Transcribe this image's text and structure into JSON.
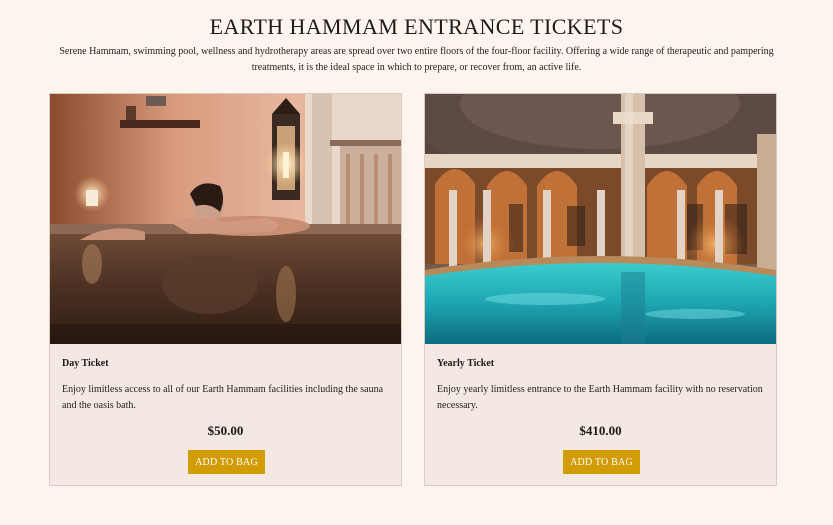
{
  "header": {
    "title": "EARTH HAMMAM ENTRANCE TICKETS",
    "intro": "Serene Hammam, swimming pool, wellness and hydrotherapy areas are spread over two entire floors of the four-floor facility. Offering a wide range of therapeutic and pampering treatments, it is the ideal space in which to prepare, or recover from, an active life."
  },
  "products": [
    {
      "name": "Day Ticket",
      "description": "Enjoy limitless access to all of our Earth Hammam facilities including the sauna and the oasis bath.",
      "price": "$50.00",
      "button_label": "ADD TO BAG"
    },
    {
      "name": "Yearly Ticket",
      "description": "Enjoy yearly limitless entrance to the Earth Hammam facility with no reservation necessary.",
      "price": "$410.00",
      "button_label": "ADD TO BAG"
    }
  ],
  "colors": {
    "page_background": "#fdf4ee",
    "card_background": "#f3e9e2",
    "button_background": "#d29c05",
    "button_text": "#ffffff"
  }
}
